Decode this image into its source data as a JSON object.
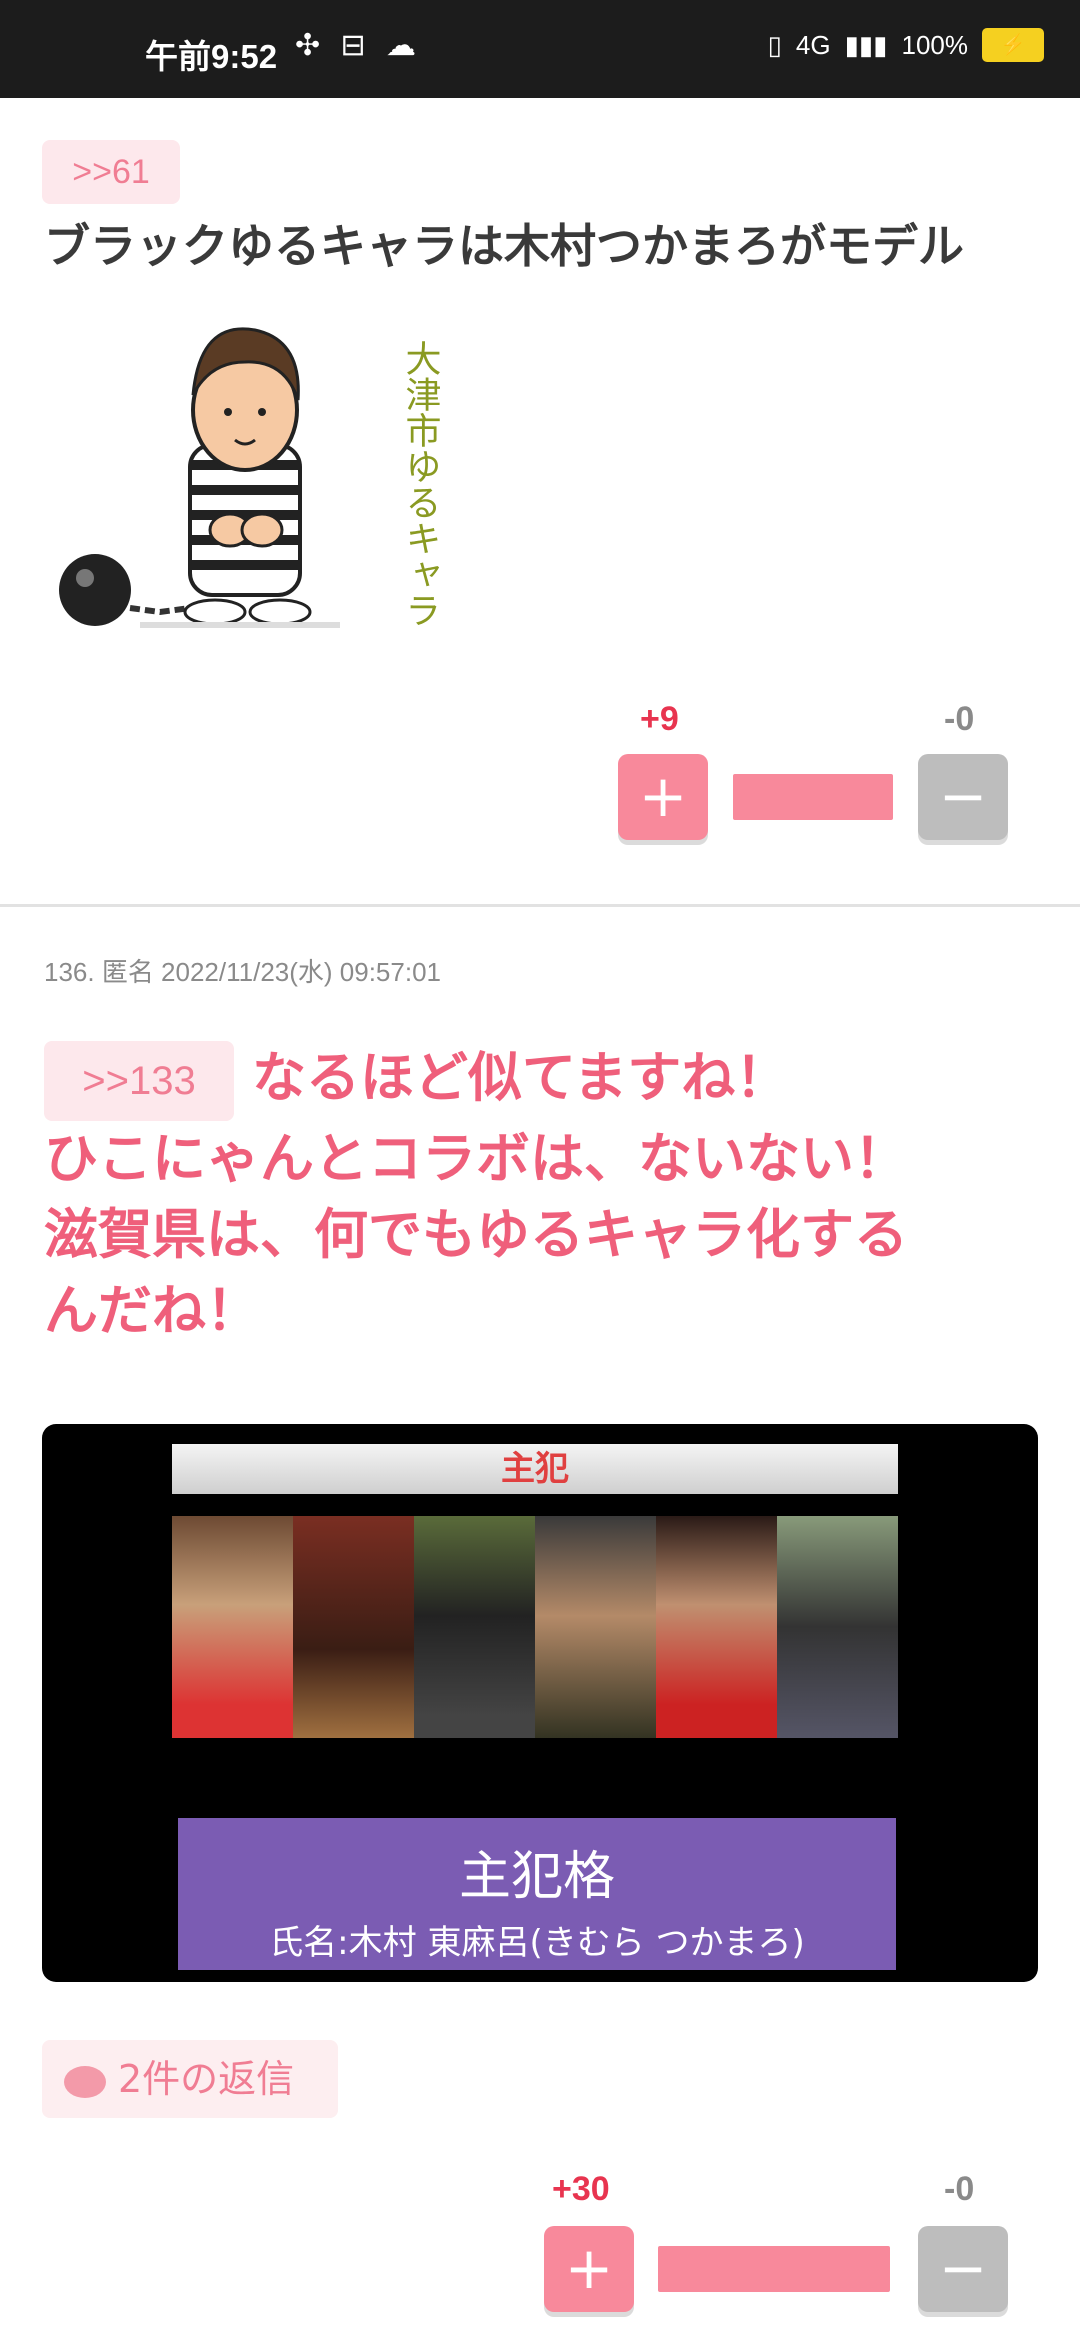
{
  "status_bar": {
    "time": "午前9:52",
    "left_icons": "✣ ⊟ ☁",
    "signal": "4G",
    "battery_percent": "100%"
  },
  "post_61": {
    "anchor": ">>61",
    "title": "ブラックゆるキャラは木村つかまろがモデル",
    "illustration_text": "大津市ゆるキャラ",
    "plus_count": "+9",
    "minus_count": "-0",
    "plus_label": "+",
    "minus_label": "−"
  },
  "post_136": {
    "meta": "136. 匿名 2022/11/23(水) 09:57:01",
    "anchor": ">>133",
    "text_line1": "なるほど似てますね！",
    "text_line2": "ひこにゃんとコラボは、ないない！",
    "text_line3": "滋賀県は、何でもゆるキャラ化する",
    "text_line4": "んだね！",
    "image": {
      "top_title": "主犯",
      "label_main": "主犯格",
      "label_sub": "氏名:木村 東麻呂(きむら つかまろ)"
    },
    "reply_count": "2件の返信",
    "plus_count": "+30",
    "minus_count": "-0",
    "plus_label": "+",
    "minus_label": "−"
  },
  "colors": {
    "accent_pink": "#f8899b",
    "text_pink": "#ef5f7b",
    "minus_gray": "#bdbdbd"
  }
}
